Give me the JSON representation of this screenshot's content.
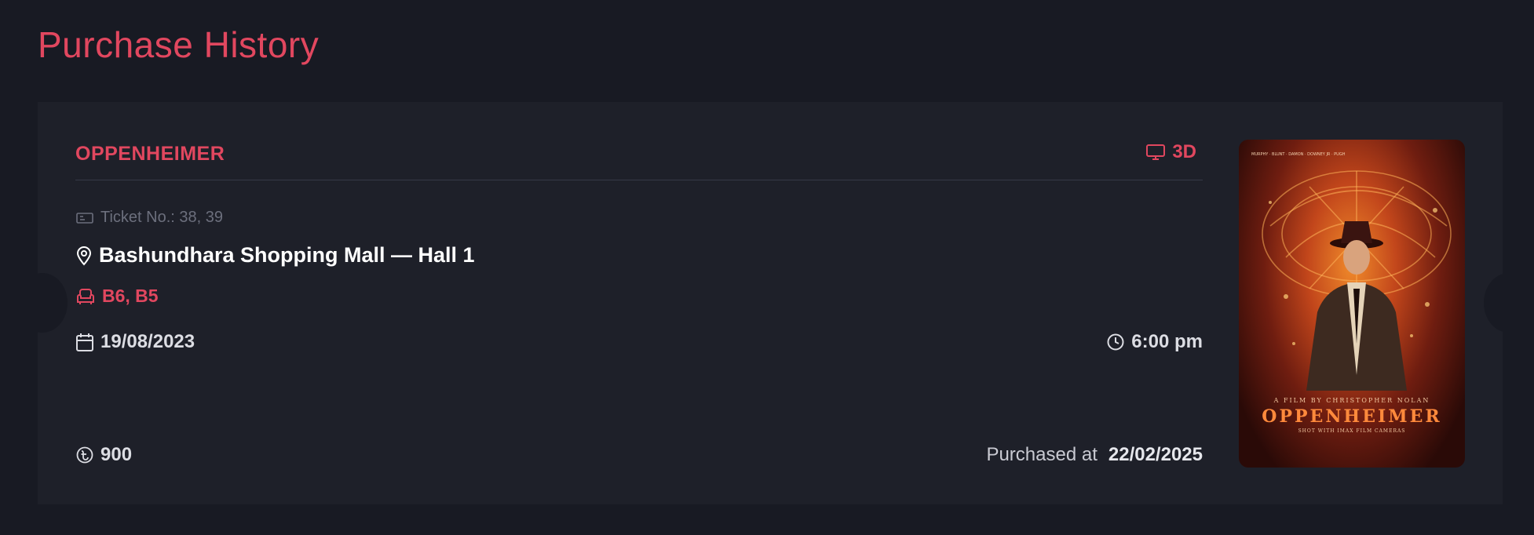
{
  "page": {
    "title": "Purchase History"
  },
  "purchase": {
    "movie_title": "OPPENHEIMER",
    "format": "3D",
    "ticket_label": "Ticket No.: 38, 39",
    "venue": "Bashundhara Shopping Mall — Hall 1",
    "seats": "B6, B5",
    "date": "19/08/2023",
    "time": "6:00 pm",
    "price": "900",
    "purchased_prefix": "Purchased at",
    "purchased_date": "22/02/2025"
  },
  "poster": {
    "credit": "A FILM BY CHRISTOPHER NOLAN",
    "name": "OPPENHEIMER",
    "tagline": "SHOT WITH IMAX FILM CAMERAS"
  },
  "colors": {
    "accent": "#e1475f",
    "background": "#181a23",
    "card": "#1e2029",
    "muted_text": "#6c6f7d"
  },
  "icons": {
    "format": "monitor-icon",
    "ticket": "ticket-icon",
    "venue": "map-pin-icon",
    "seats": "armchair-icon",
    "date": "calendar-icon",
    "time": "clock-icon",
    "price": "taka-icon"
  }
}
